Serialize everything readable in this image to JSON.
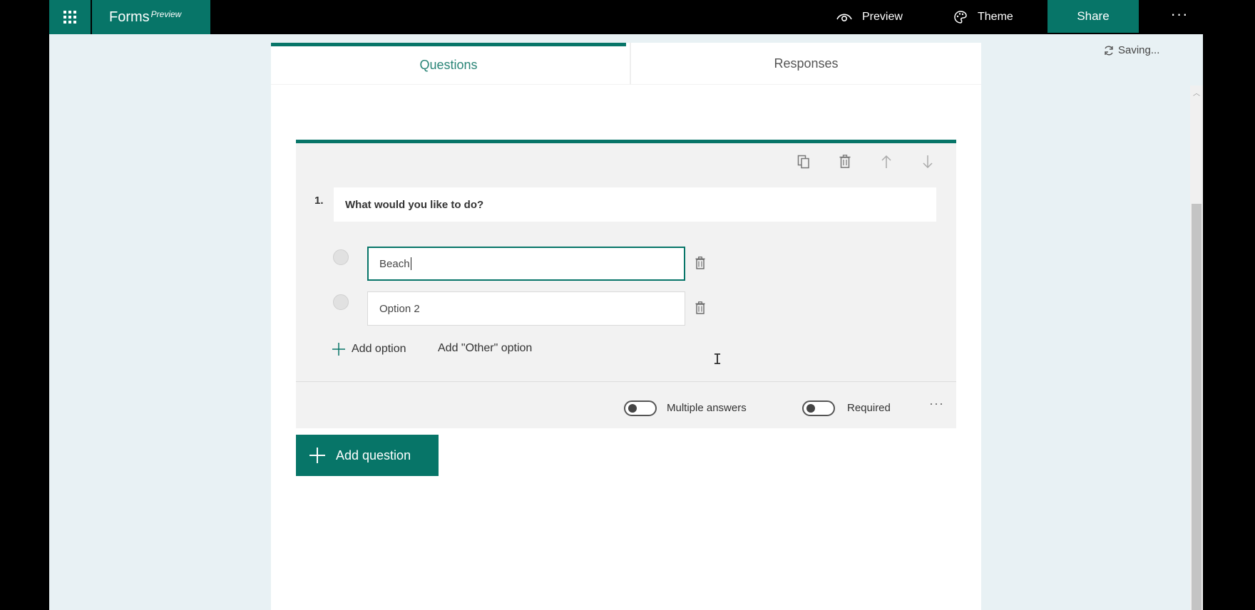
{
  "app": {
    "name": "Forms",
    "tag": "Preview"
  },
  "header": {
    "preview_label": "Preview",
    "theme_label": "Theme",
    "share_label": "Share",
    "more_label": "···",
    "saving_status": "Saving..."
  },
  "tabs": [
    {
      "label": "Questions",
      "active": true
    },
    {
      "label": "Responses",
      "active": false
    }
  ],
  "question": {
    "number": "1.",
    "title": "What would you like to do?",
    "options": [
      {
        "value": "Beach",
        "active": true
      },
      {
        "value": "Option 2",
        "active": false
      }
    ],
    "add_option_label": "Add option",
    "add_other_label": "Add \"Other\" option",
    "multiple_answers_label": "Multiple answers",
    "multiple_answers_on": false,
    "required_label": "Required",
    "required_on": false,
    "more_label": "···"
  },
  "add_question_label": "Add question",
  "colors": {
    "accent": "#077568",
    "page_background": "#e8f1f4",
    "card_background": "#f2f2f2"
  },
  "icons": [
    "waffle-icon",
    "eye-icon",
    "palette-icon",
    "refresh-icon",
    "copy-icon",
    "trash-icon",
    "arrow-up-icon",
    "arrow-down-icon",
    "plus-icon",
    "text-cursor-icon"
  ]
}
